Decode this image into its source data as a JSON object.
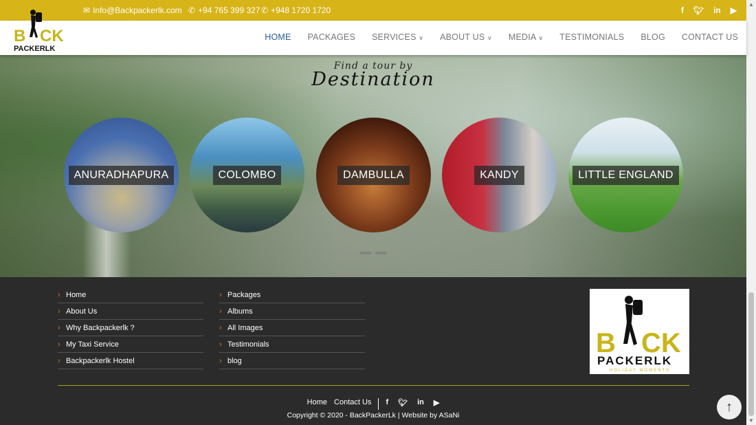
{
  "topbar": {
    "email": "Info@Backpackerlk.com",
    "phone1": "+94 765 399 327",
    "phone2": "+948 1720 1720",
    "social": [
      "f",
      "t",
      "in",
      "yt"
    ]
  },
  "colors": {
    "accent": "#d7b418",
    "nav_active": "#2a5aa0",
    "footer_bg": "#2b2b2b",
    "arrow": "#e8721c"
  },
  "nav": {
    "items": [
      {
        "label": "HOME",
        "active": true
      },
      {
        "label": "PACKAGES",
        "active": false
      },
      {
        "label": "SERVICES",
        "caret": "∨"
      },
      {
        "label": "ABOUT US",
        "caret": "∨"
      },
      {
        "label": "MEDIA",
        "caret": "∨"
      },
      {
        "label": "TESTIMONIALS"
      },
      {
        "label": "BLOG"
      },
      {
        "label": "CONTACT US"
      }
    ]
  },
  "logo": {
    "line1": "BACK",
    "line2": "PACKERLK"
  },
  "hero": {
    "subtitle": "Find a tour by",
    "title": "Destination",
    "destinations": [
      "ANURADHAPURA",
      "COLOMBO",
      "DAMBULLA",
      "KANDY",
      "LITTLE ENGLAND"
    ]
  },
  "footer": {
    "col1": [
      "Home",
      "About Us",
      "Why Backpackerlk ?",
      "My Taxi Service",
      "Backpackerlk Hostel"
    ],
    "col2": [
      "Packages",
      "Albums",
      "All Images",
      "Testimonials",
      "blog"
    ],
    "bottom_links": [
      "Home",
      "Contact Us"
    ],
    "copyright": "Copyright © 2020 - BackPackerLk",
    "credit": "Website by ASaNi",
    "logo_tagline": "HOLIDAY MOMENTS"
  }
}
